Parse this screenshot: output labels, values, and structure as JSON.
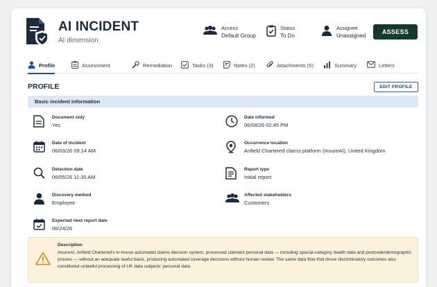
{
  "header": {
    "title": "AI INCIDENT",
    "subtitle": "AI dimension",
    "access": {
      "label": "Access",
      "value": "Default Group"
    },
    "status": {
      "label": "Status",
      "value": "To Do"
    },
    "assignee": {
      "label": "Assignee",
      "value": "Unassigned"
    },
    "assess_label": "ASSESS",
    "accent_color": "#123b2b"
  },
  "tabs": [
    {
      "label": "Profile",
      "icon": "person-icon",
      "active": true
    },
    {
      "label": "Assessment",
      "icon": "clipboard-icon"
    },
    {
      "label": "Remediation",
      "icon": "wrench-icon"
    },
    {
      "label": "Tasks (3)",
      "icon": "checkbox-icon"
    },
    {
      "label": "Notes (2)",
      "icon": "note-icon"
    },
    {
      "label": "Attachments (5)",
      "icon": "paperclip-icon"
    },
    {
      "label": "Summary",
      "icon": "bar-chart-icon"
    },
    {
      "label": "Letters",
      "icon": "envelope-icon"
    }
  ],
  "profile": {
    "title": "PROFILE",
    "edit_label": "EDIT PROFILE",
    "section_label": "Basic incident information",
    "fields": {
      "document_only": {
        "label": "Document only",
        "value": "Yes",
        "icon": "document-icon"
      },
      "date_informed": {
        "label": "Date informed",
        "value": "06/08/26 02:45 PM",
        "icon": "clock-icon"
      },
      "date_of_incident": {
        "label": "Date of incident",
        "value": "06/03/26 09:14 AM",
        "icon": "calendar-icon"
      },
      "occurrence_location": {
        "label": "Occurrence location",
        "value": "Anfield Chartered claims platform (InsureAI), United Kingdom",
        "icon": "location-pin-icon"
      },
      "detection_date": {
        "label": "Detection date",
        "value": "06/05/26 11:30 AM",
        "icon": "search-icon"
      },
      "report_type": {
        "label": "Report type",
        "value": "Initial report",
        "icon": "report-icon"
      },
      "discovery_method": {
        "label": "Discovery method",
        "value": "Employee",
        "icon": "person-icon"
      },
      "affected_stakeholders": {
        "label": "Affected stakeholders",
        "value": "Customers",
        "icon": "group-icon"
      },
      "expected_next_report_date": {
        "label": "Expected next report date",
        "value": "06/24/26",
        "icon": "calendar-check-icon"
      }
    },
    "description": {
      "label": "Description",
      "text": "InsureAI, Anfield Chartered's in-house automated claims decision system, processed claimant personal data — including special-category health data and postcode/demographic proxies — without an adequate lawful basis, producing automated coverage decisions without human review. The same data flow that drove discriminatory outcomes also constituted unlawful processing of UK data subjects' personal data.",
      "icon": "warning-icon"
    }
  }
}
